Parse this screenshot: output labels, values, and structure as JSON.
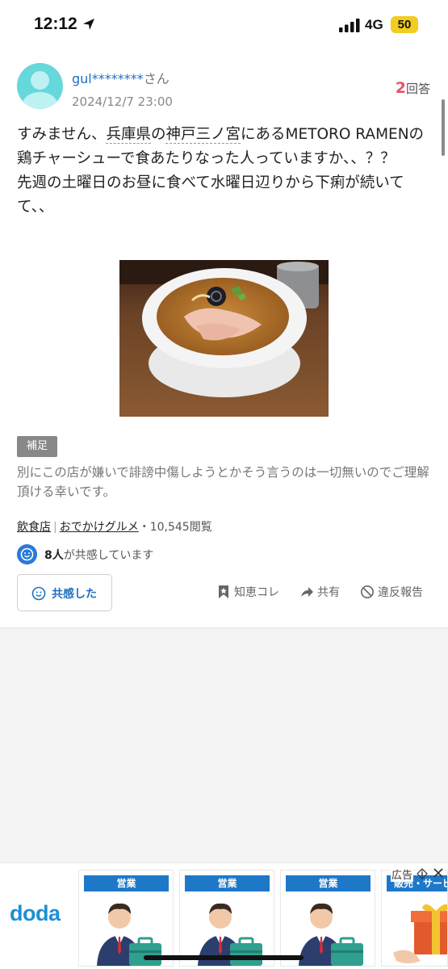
{
  "status_bar": {
    "time": "12:12",
    "network": "4G",
    "battery": "50",
    "battery_color": "#f2cc1f"
  },
  "question": {
    "user": {
      "name": "gul********",
      "suffix": "さん"
    },
    "date": "2024/12/7 23:00",
    "answers": {
      "count": "2",
      "label": "回答"
    },
    "text": {
      "p1": "すみません、",
      "kw1": "兵庫県",
      "p2": "の",
      "kw2": "神戸三ノ宮",
      "p3": "にあるMETORO RAMENの鶏チャーシューで食あたりなった人っていますか、、？？",
      "p4": "先週の土曜日のお昼に食べて水曜日辺りから下痢が続いてて、、"
    },
    "photo_alt": "ramen-bowl-photo",
    "supplement": {
      "badge": "補足",
      "text": "別にこの店が嫌いで誹謗中傷しようとかそう言うのは一切無いのでご理解頂ける幸いです。"
    },
    "meta": {
      "category1": "飲食店",
      "separator": "|",
      "category2": "おでかけグルメ",
      "views": "・10,545閲覧"
    },
    "empathy": {
      "count": "8人",
      "text": "が共感しています"
    },
    "empathy_button": "共感した",
    "actions": {
      "bookmark": "知恵コレ",
      "share": "共有",
      "report": "違反報告"
    }
  },
  "ad": {
    "logo": "doda",
    "label": "広告",
    "cards": [
      {
        "header": "営業"
      },
      {
        "header": "営業"
      },
      {
        "header": "営業"
      },
      {
        "header": "販売・サービ"
      }
    ]
  },
  "colors": {
    "link_blue": "#1f6fbf",
    "answer_red": "#e5536b",
    "avatar": "#66d7db",
    "ad_blue": "#1e78c8"
  }
}
